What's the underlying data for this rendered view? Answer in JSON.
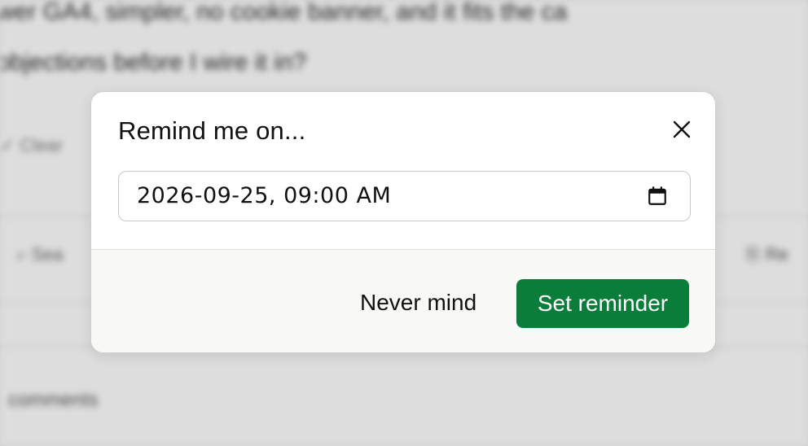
{
  "background": {
    "line1": "wer GA4, simpler, no cookie banner, and it fits the ca",
    "line2": "objections before I wire it in?",
    "meta": "✓ Clear",
    "search": "⌕ Sea",
    "right": "⎘ Re",
    "comments": "comments"
  },
  "dialog": {
    "title": "Remind me on...",
    "datetime": {
      "value": "2026-09-25, 09:00 AM"
    },
    "buttons": {
      "cancel_label": "Never mind",
      "confirm_label": "Set reminder"
    }
  },
  "icons": {
    "close": "close-icon",
    "calendar": "calendar-icon"
  },
  "colors": {
    "primary": "#0b7d3b",
    "footer_bg": "#f8f8f6",
    "border": "#c9c9c9"
  }
}
